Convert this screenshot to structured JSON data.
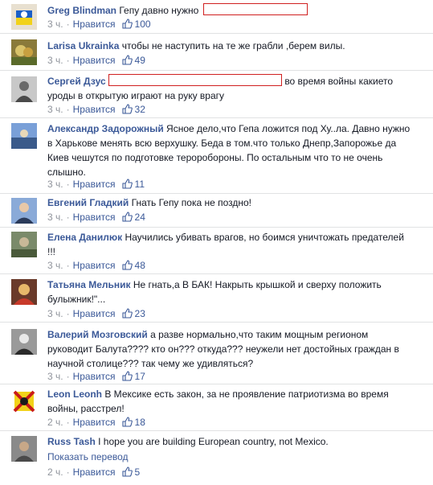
{
  "comments": [
    {
      "name": "Greg Blindman",
      "text": "Гепу давно нужно",
      "redact_after": true,
      "time": "3 ч.",
      "like": "Нравится",
      "count": "100",
      "avatar_colors": [
        "#e8e0d0",
        "#1a5fc8",
        "#f2d21a"
      ]
    },
    {
      "name": "Larisa Ukrainka",
      "text": "чтобы не наступить на те же грабли ,берем вилы.",
      "time": "3 ч.",
      "like": "Нравится",
      "count": "49",
      "avatar_colors": [
        "#8a7a3a",
        "#d9c36a",
        "#5a6a2a"
      ]
    },
    {
      "name": "Сергей Дзус",
      "text_before": "",
      "text": "во время войны какието уроды в открытую играют на руку врагу",
      "redact_before": true,
      "time": "3 ч.",
      "like": "Нравится",
      "count": "32",
      "avatar_colors": [
        "#c8c8c8",
        "#6a6a6a",
        "#f2f2f2"
      ]
    },
    {
      "name": "Александр Задорожный",
      "text": "Ясное дело,что Гепа ложится под Ху..ла. Давно нужно в Харькове менять всю верхушку. Беда в том.что только Днепр,Запорожье да Киев чешутся по подготовке тероробороны. По остальным что то не очень слышно.",
      "time": "3 ч.",
      "like": "Нравится",
      "count": "11",
      "avatar_colors": [
        "#7aa0d8",
        "#3a5a8a",
        "#e8d8b8"
      ]
    },
    {
      "name": "Евгений Гладкий",
      "text": "Гнать Гепу пока не поздно!",
      "time": "3 ч.",
      "like": "Нравится",
      "count": "24",
      "avatar_colors": [
        "#8aaad8",
        "#2a3a5a",
        "#e8c8a8"
      ]
    },
    {
      "name": "Елена Данилюк",
      "text": "Научились убивать врагов, но боимся уничтожать предателей !!!",
      "time": "3 ч.",
      "like": "Нравится",
      "count": "48",
      "avatar_colors": [
        "#7a8a6a",
        "#c8b898",
        "#4a5a3a"
      ]
    },
    {
      "name": "Татьяна Мельник",
      "text": "Не гнать,а В БАК! Накрыть крышкой и сверху положить булыжник!\"...",
      "time": "3 ч.",
      "like": "Нравится",
      "count": "23",
      "avatar_colors": [
        "#c83a2a",
        "#e8b86a",
        "#6a3a2a"
      ]
    },
    {
      "name": "Валерий Мозговский",
      "text": "а разве нормально,что таким мощным регионом руководит Балута???? кто он??? откуда??? неужели нет достойных граждан в научной столице??? так чему же удивляться?",
      "time": "3 ч.",
      "like": "Нравится",
      "count": "17",
      "avatar_colors": [
        "#2a2a2a",
        "#9a9a9a",
        "#e8e8e8"
      ]
    },
    {
      "name": "Leon Leonh",
      "text": "В Мексике есть закон, за не проявление патриотизма во время войны, расстрел!",
      "time": "2 ч.",
      "like": "Нравится",
      "count": "18",
      "avatar_colors": [
        "#f2d21a",
        "#c81a1a",
        "#1a1a1a"
      ]
    },
    {
      "name": "Russ Tash",
      "text": "I hope you are building European country, not Mexico.",
      "translate": "Показать перевод",
      "time": "2 ч.",
      "like": "Нравится",
      "count": "5",
      "avatar_colors": [
        "#4a4a4a",
        "#c8a888",
        "#8a8a8a"
      ]
    }
  ]
}
